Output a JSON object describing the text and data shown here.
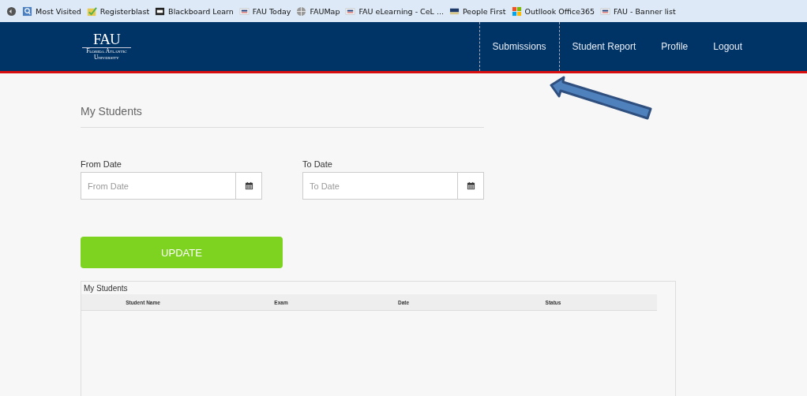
{
  "bookmarks": [
    {
      "label": "Most Visited",
      "kind": "search"
    },
    {
      "label": "Registerblast",
      "kind": "check"
    },
    {
      "label": "Blackboard Learn",
      "kind": "bb"
    },
    {
      "label": "FAU Today",
      "kind": "fau"
    },
    {
      "label": "FAUMap",
      "kind": "globe"
    },
    {
      "label": "FAU eLearning - CeL ...",
      "kind": "fau"
    },
    {
      "label": "People First",
      "kind": "flag"
    },
    {
      "label": "Outllook Office365",
      "kind": "windows"
    },
    {
      "label": "FAU - Banner list",
      "kind": "fau"
    }
  ],
  "logo": {
    "mark": "FAU",
    "name_line_1": "Florida Atlantic",
    "name_line_2": "University"
  },
  "nav": [
    {
      "label": "Submissions",
      "selected": true
    },
    {
      "label": "Student Report",
      "selected": false
    },
    {
      "label": "Profile",
      "selected": false
    },
    {
      "label": "Logout",
      "selected": false
    }
  ],
  "page_title": "My Students",
  "from_date": {
    "label": "From Date",
    "placeholder": "From Date"
  },
  "to_date": {
    "label": "To Date",
    "placeholder": "To Date"
  },
  "update_button": "UPDATE",
  "table": {
    "title": "My Students",
    "columns": [
      "Student Name",
      "Exam",
      "Date",
      "Status"
    ]
  }
}
